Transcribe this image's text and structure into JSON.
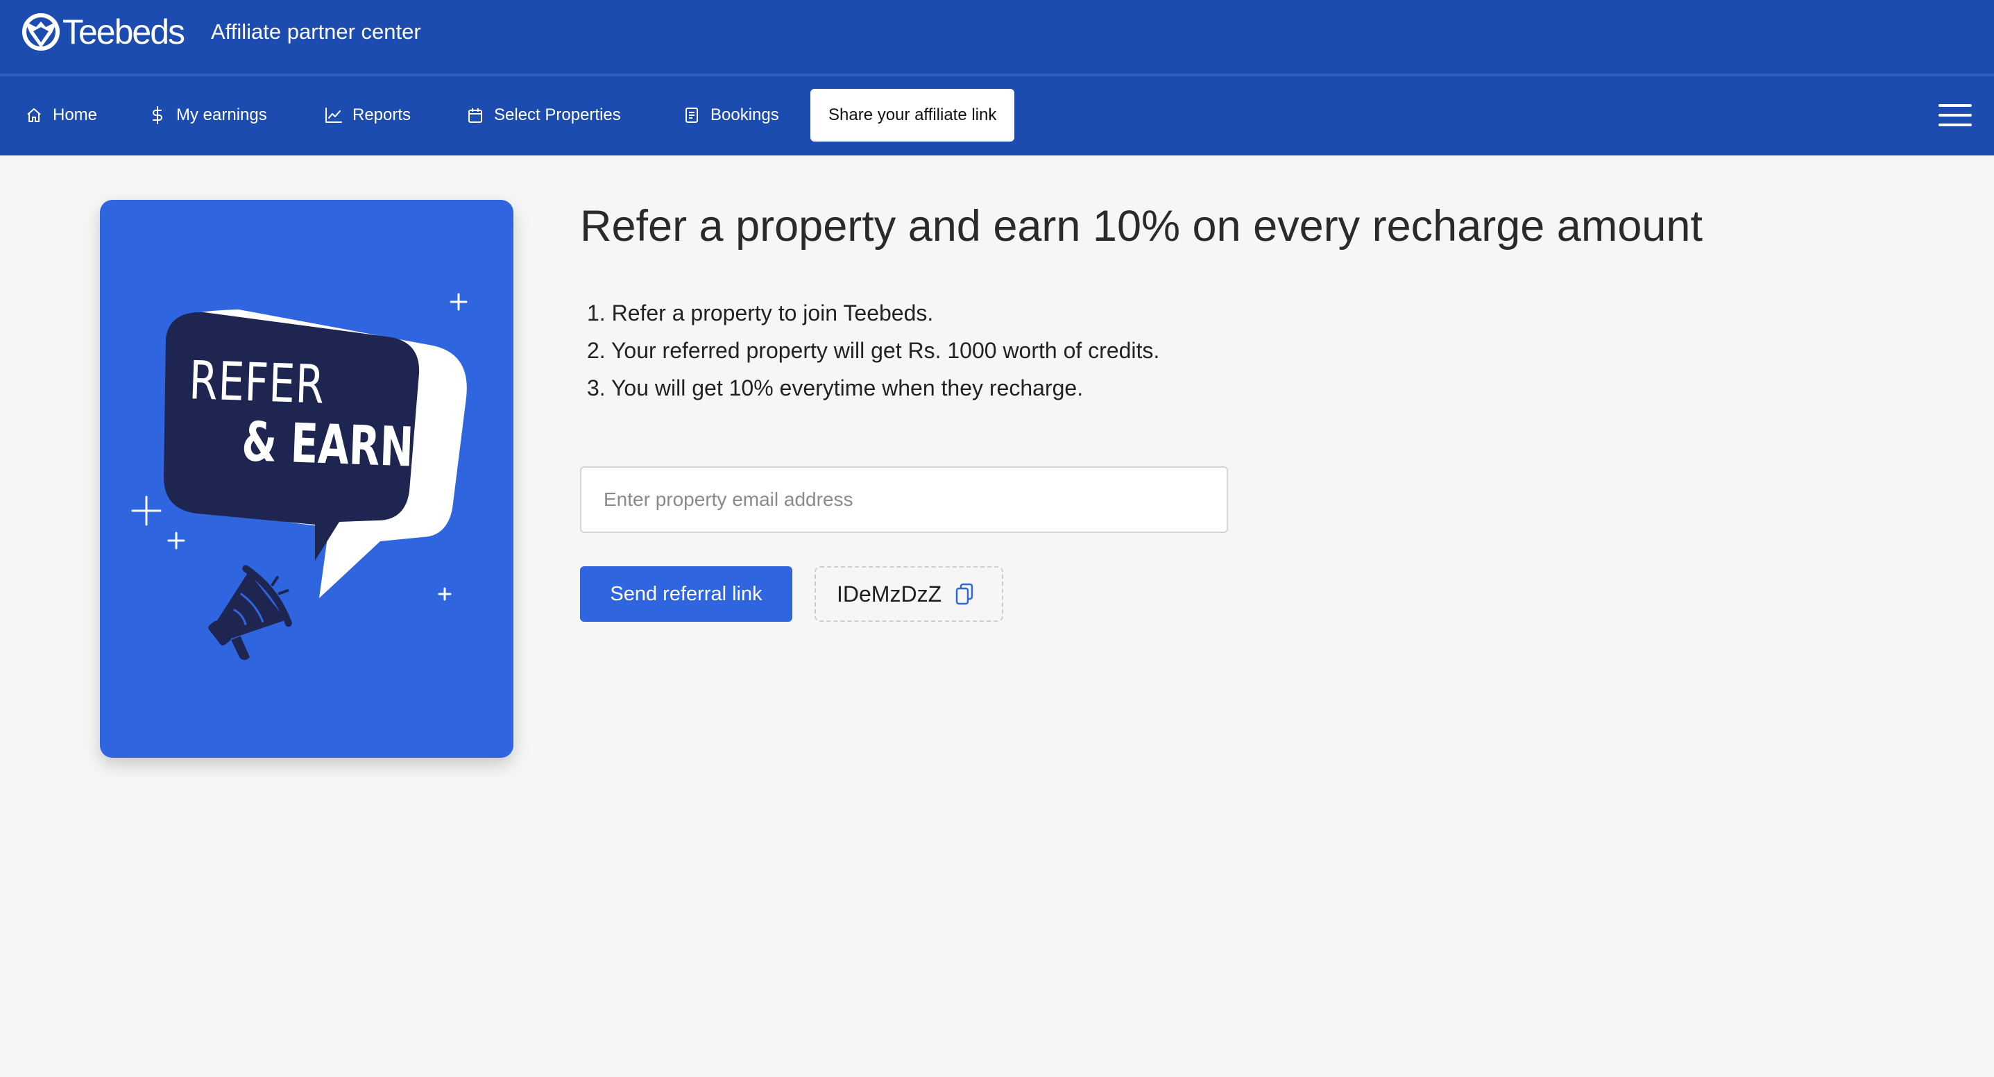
{
  "header": {
    "logo_text": "Teebeds",
    "app_title": "Affiliate partner center"
  },
  "nav": {
    "items": [
      {
        "label": "Home",
        "icon": "home-icon"
      },
      {
        "label": "My earnings",
        "icon": "dollar-icon"
      },
      {
        "label": "Reports",
        "icon": "chart-line-icon"
      },
      {
        "label": "Select Properties",
        "icon": "calendar-icon"
      },
      {
        "label": "Bookings",
        "icon": "document-icon"
      },
      {
        "label": "Share your affiliate link",
        "active": true
      }
    ],
    "menu_icon": "hamburger-menu-icon"
  },
  "promo": {
    "line1": "REFER",
    "line2": "& EARN",
    "illustration": "megaphone-speech-bubble",
    "colors": {
      "card": "#2f66e0",
      "bubble": "#1e2550"
    }
  },
  "main": {
    "headline": "Refer a property and earn 10% on every recharge amount",
    "steps": [
      "1. Refer a property to join Teebeds.",
      "2. Your referred property will get Rs. 1000 worth of credits.",
      "3. You will get 10% everytime when they recharge."
    ],
    "email_placeholder": "Enter property email address",
    "email_value": "",
    "send_button_label": "Send referral link",
    "referral_code": "IDeMzDzZ",
    "copy_icon": "copy-icon"
  },
  "colors": {
    "header_bg": "#1d4cb0",
    "accent": "#2f66e0",
    "page_bg": "#f6f6f6"
  }
}
